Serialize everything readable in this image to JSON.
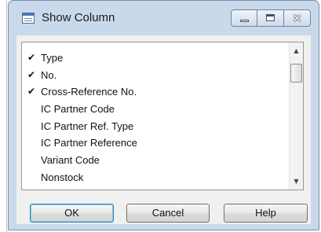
{
  "window": {
    "title": "Show Column",
    "icon": "table-icon",
    "controls": {
      "minimize": "minimize-icon",
      "maximize": "maximize-icon",
      "close": "close-icon"
    },
    "accent_color": "#c9d9ec"
  },
  "columns": [
    {
      "label": "Type",
      "checked": true
    },
    {
      "label": "No.",
      "checked": true
    },
    {
      "label": "Cross-Reference No.",
      "checked": true
    },
    {
      "label": "IC Partner Code",
      "checked": false
    },
    {
      "label": "IC Partner Ref. Type",
      "checked": false
    },
    {
      "label": "IC Partner Reference",
      "checked": false
    },
    {
      "label": "Variant Code",
      "checked": false
    },
    {
      "label": "Nonstock",
      "checked": false
    }
  ],
  "check_mark": "✔",
  "buttons": {
    "ok": "OK",
    "cancel": "Cancel",
    "help": "Help"
  }
}
